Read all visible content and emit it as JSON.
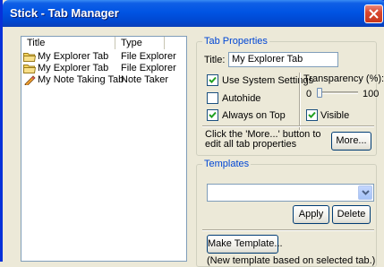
{
  "window": {
    "title": "Stick - Tab Manager"
  },
  "list": {
    "columns": [
      "Title",
      "Type"
    ],
    "rows": [
      {
        "title": "My Explorer Tab",
        "type": "File Explorer",
        "icon": "folder-icon"
      },
      {
        "title": "My Explorer Tab",
        "type": "File Explorer",
        "icon": "folder-icon"
      },
      {
        "title": "My Note Taking Tab",
        "type": "Note Taker",
        "icon": "pencil-icon"
      }
    ]
  },
  "tab_properties": {
    "group_label": "Tab Properties",
    "title_label": "Title:",
    "title_value": "My Explorer Tab",
    "use_system_settings": {
      "label": "Use System Settings",
      "checked": true
    },
    "autohide": {
      "label": "Autohide",
      "checked": false
    },
    "always_on_top": {
      "label": "Always on Top",
      "checked": true
    },
    "transparency": {
      "label": "Transparency (%):",
      "min_label": "0",
      "max_label": "100",
      "value": 0
    },
    "visible": {
      "label": "Visible",
      "checked": true
    },
    "more_hint": "Click the 'More...' button to edit all tab properties",
    "more_button": "More..."
  },
  "templates": {
    "group_label": "Templates",
    "selected": "",
    "apply_button": "Apply",
    "delete_button": "Delete",
    "make_button": "Make Template...",
    "make_hint": "(New template based on selected tab.)"
  },
  "colors": {
    "titlebar": "#0054e3",
    "group_label": "#0046d5",
    "close": "#d9482f"
  }
}
